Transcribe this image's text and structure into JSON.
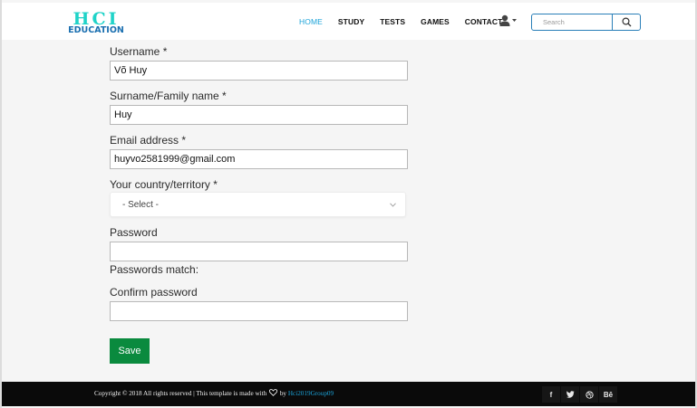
{
  "header": {
    "logo": {
      "top_text": "HCI",
      "bottom_text": "EDUCATION",
      "color": "#1fd3c8"
    },
    "nav": [
      {
        "label": "HOME",
        "active": true
      },
      {
        "label": "STUDY"
      },
      {
        "label": "TESTS"
      },
      {
        "label": "GAMES"
      },
      {
        "label": "CONTACT"
      }
    ],
    "user_menu_icon": "user-dropdown-icon",
    "search": {
      "placeholder": "Search",
      "icon": "search-icon"
    }
  },
  "form": {
    "username": {
      "label": "Username *",
      "value": "Võ Huy"
    },
    "surname": {
      "label": "Surname/Family name *",
      "value": "Huy"
    },
    "email": {
      "label": "Email address *",
      "value": "huyvo2581999@gmail.com"
    },
    "country": {
      "label": "Your country/territory *",
      "selected": "- Select -"
    },
    "password": {
      "label": "Password",
      "value": ""
    },
    "passwords_match": {
      "label": "Passwords match:"
    },
    "confirm_password": {
      "label": "Confirm password",
      "value": ""
    },
    "save_label": "Save"
  },
  "footer": {
    "copyright_prefix": "Copyright © 2018 All rights reserved | This template is made with",
    "copyright_by": "by",
    "copyright_link": "Hci2019Group09",
    "socials": [
      {
        "label": "f",
        "icon": "facebook-icon"
      },
      {
        "label": "",
        "icon": "twitter-icon"
      },
      {
        "label": "",
        "icon": "dribbble-icon"
      },
      {
        "label": "Bē",
        "icon": "behance-icon"
      }
    ]
  },
  "colors": {
    "accent": "#1ba3d9",
    "save_button": "#0a8a3e",
    "footer_bg": "#0a0a0a",
    "page_bg": "#f5f5f5"
  }
}
